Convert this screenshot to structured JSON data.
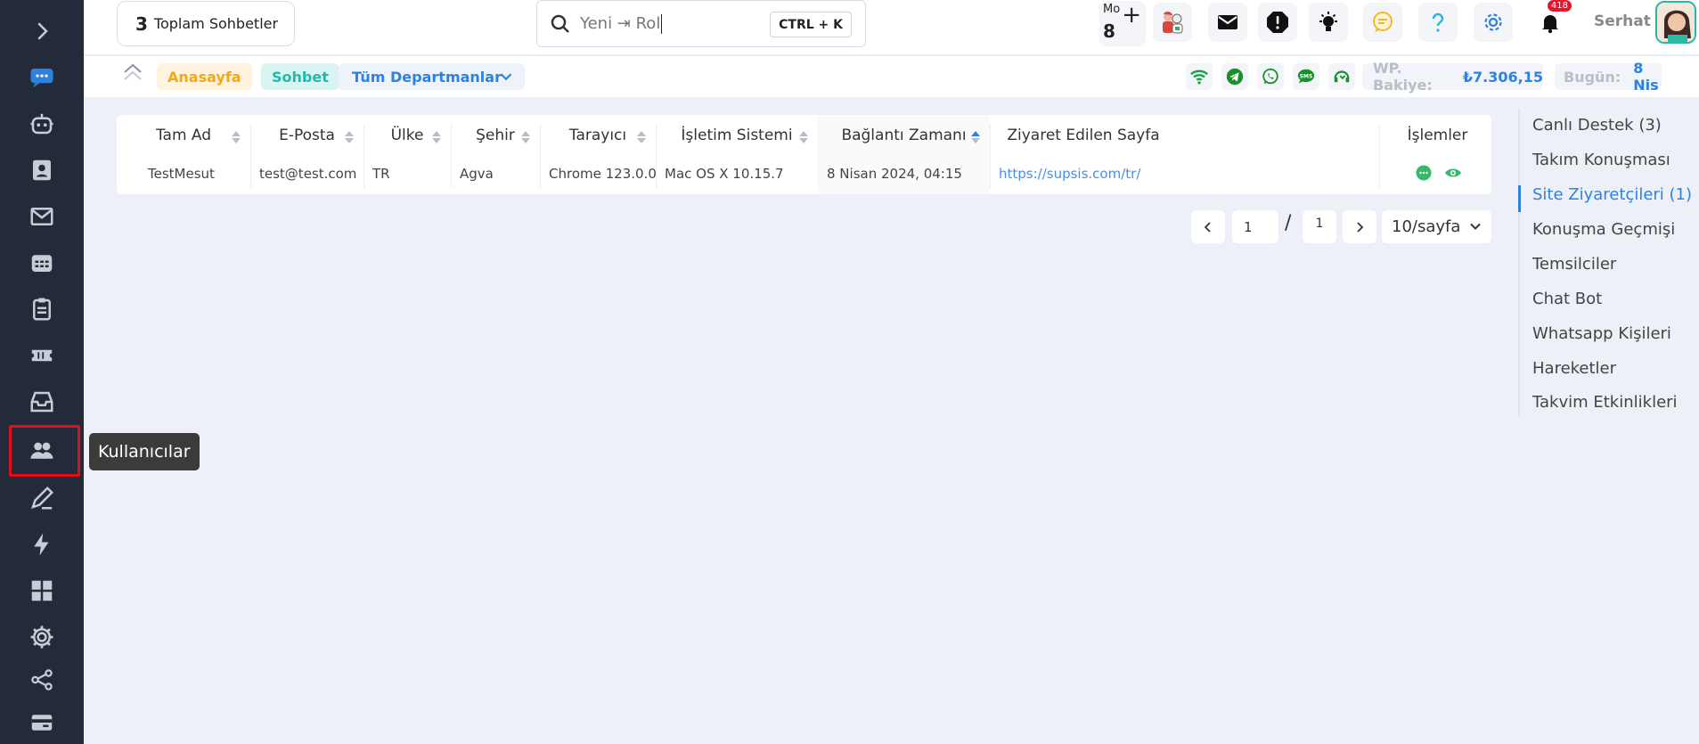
{
  "sidebar": {
    "items": [
      {
        "icon": "chevron-right-icon"
      },
      {
        "icon": "chat-bubbles-icon"
      },
      {
        "icon": "robot-icon"
      },
      {
        "icon": "contact-card-icon"
      },
      {
        "icon": "mail-icon"
      },
      {
        "icon": "calendar-grid-icon"
      },
      {
        "icon": "clipboard-icon"
      },
      {
        "icon": "ticket-icon"
      },
      {
        "icon": "archive-box-icon"
      },
      {
        "icon": "users-icon"
      },
      {
        "icon": "pen-note-icon"
      },
      {
        "icon": "lightning-icon"
      },
      {
        "icon": "dashboard-tiles-icon"
      },
      {
        "icon": "gear-icon"
      },
      {
        "icon": "share-icon"
      },
      {
        "icon": "id-card-icon"
      }
    ],
    "tooltip": "Kullanıcılar",
    "highlighted_item": "users-icon"
  },
  "header": {
    "total_count": "3",
    "total_label": "Toplam Sohbetler",
    "search_text": "Yeni ⇥ Rol",
    "search_shortcut": "CTRL + K",
    "mo_label": "Mo",
    "mo_count": "8",
    "notification_badge": "418",
    "user_name": "Serhat",
    "colors": {
      "accent": "#2e82de",
      "badge": "#e8132d"
    }
  },
  "subbar": {
    "home_chip": "Anasayfa",
    "chat_chip": "Sohbet",
    "department": "Tüm Departmanlar",
    "wp_label": "WP. Bakiye:",
    "wp_value": "₺7.306,15",
    "today_label": "Bugün:",
    "today_value": "8 Nis"
  },
  "table": {
    "columns": [
      "Tam Ad",
      "E-Posta",
      "Ülke",
      "Şehir",
      "Tarayıcı",
      "İşletim Sistemi",
      "Bağlantı Zamanı",
      "Ziyaret Edilen Sayfa",
      "İşlemler"
    ],
    "rows": [
      {
        "name": "TestMesut",
        "email": "test@test.com",
        "country": "TR",
        "city": "Agva",
        "browser": "Chrome 123.0.0",
        "os": "Mac OS X 10.15.7",
        "connected_at": "8 Nisan 2024, 04:15",
        "page": "https://supsis.com/tr/"
      }
    ]
  },
  "pagination": {
    "current": "1",
    "separator": "/",
    "total": "1",
    "page_size": "10/sayfa"
  },
  "right_menu": {
    "items": [
      {
        "label": "Canlı Destek (3)",
        "active": false
      },
      {
        "label": "Takım Konuşması",
        "active": false
      },
      {
        "label": "Site Ziyaretçileri (1)",
        "active": true
      },
      {
        "label": "Konuşma Geçmişi",
        "active": false
      },
      {
        "label": "Temsilciler",
        "active": false
      },
      {
        "label": "Chat Bot",
        "active": false
      },
      {
        "label": "Whatsapp Kişileri",
        "active": false
      },
      {
        "label": "Hareketler",
        "active": false
      },
      {
        "label": "Takvim Etkinlikleri",
        "active": false
      }
    ]
  }
}
